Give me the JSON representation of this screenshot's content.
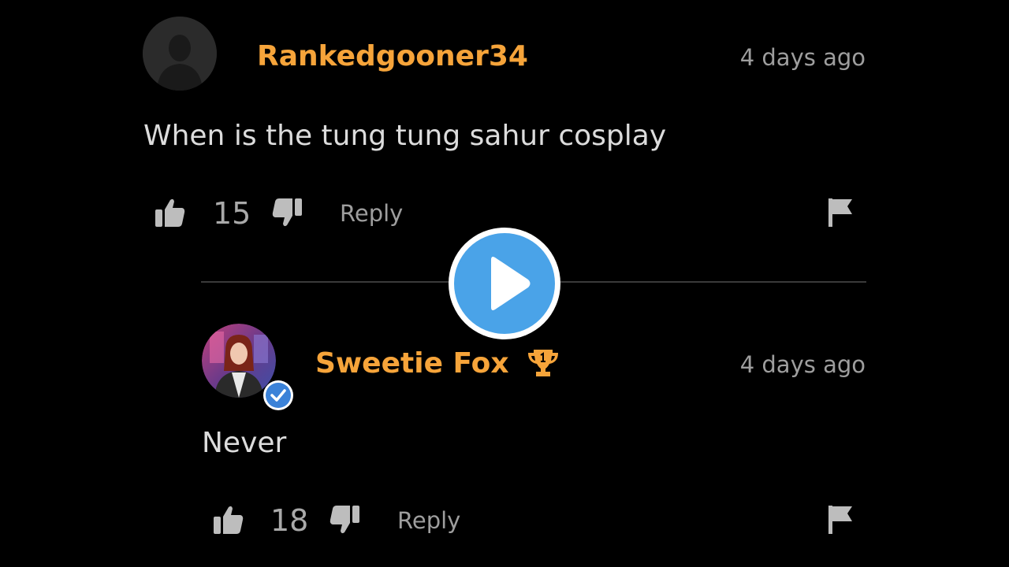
{
  "comments": [
    {
      "username": "Rankedgooner34",
      "timestamp": "4 days ago",
      "text": "When is the tung tung sahur cosplay",
      "likes": "15",
      "reply_label": "Reply",
      "avatar": "default-user-silhouette"
    }
  ],
  "replies": [
    {
      "username": "Sweetie Fox",
      "timestamp": "4 days ago",
      "text": "Never",
      "likes": "18",
      "reply_label": "Reply",
      "badges": [
        "trophy-icon",
        "verified-icon"
      ]
    }
  ],
  "colors": {
    "background": "#000000",
    "username": "#f6a43a",
    "play_button": "#4aa3e8",
    "divider": "#3a3a3a"
  }
}
